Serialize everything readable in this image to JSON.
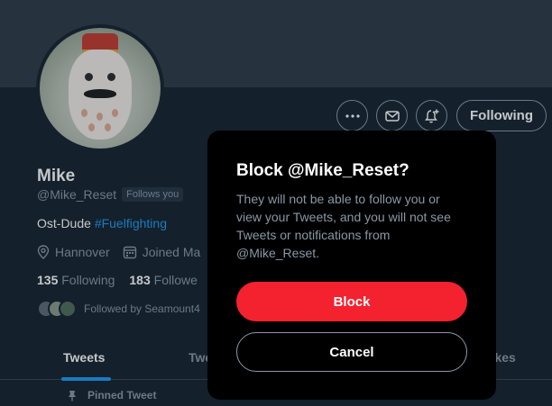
{
  "profile": {
    "name": "Mike",
    "handle": "@Mike_Reset",
    "follows_you": "Follows you",
    "bio_text": "Ost-Dude ",
    "bio_hashtag": "#Fuelfighting",
    "location": "Hannover",
    "joined": "Joined Ma",
    "following_count": "135",
    "following_label": "Following",
    "followers_count": "183",
    "followers_label": "Followe",
    "followed_by": "Followed by Seamount4"
  },
  "actions": {
    "more_icon": "more-dots-icon",
    "message_icon": "mail-icon",
    "notify_icon": "bell-plus-icon",
    "following_label": "Following"
  },
  "tabs": [
    {
      "label": "Tweets"
    },
    {
      "label": "Twe"
    },
    {
      "label": "Likes"
    }
  ],
  "pinned": {
    "label": "Pinned Tweet"
  },
  "modal": {
    "title": "Block @Mike_Reset?",
    "description": "They will not be able to follow you or view your Tweets, and you will not see Tweets or notifications from @Mike_Reset.",
    "block_label": "Block",
    "cancel_label": "Cancel"
  },
  "colors": {
    "background": "#15202b",
    "accent": "#1d9bf0",
    "danger": "#f4212e",
    "muted_text": "#8899a6"
  }
}
